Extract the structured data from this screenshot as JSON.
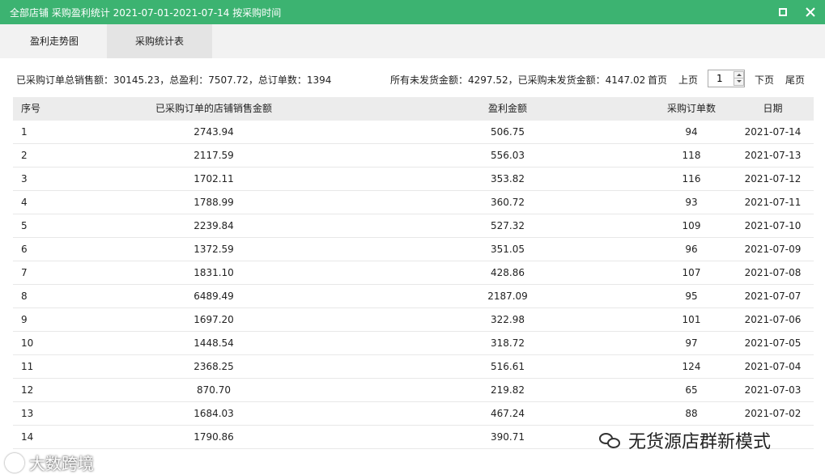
{
  "window": {
    "title": "全部店铺 采购盈利统计 2021-07-01-2021-07-14 按采购时间",
    "maximize_icon": "maximize-icon",
    "close_icon": "close-icon",
    "titlebar_color": "#3cb371"
  },
  "tabs": [
    {
      "label": "盈利走势图",
      "active": false
    },
    {
      "label": "采购统计表",
      "active": true
    }
  ],
  "summary": {
    "left": "已采购订单总销售额：30145.23，总盈利：7507.72，总订单数：1394",
    "right": "所有未发货金额：4297.52，已采购未发货金额：4147.02"
  },
  "pager": {
    "first": "首页",
    "prev": "上页",
    "page": "1",
    "next": "下页",
    "last": "尾页"
  },
  "table": {
    "headers": [
      "序号",
      "已采购订单的店铺销售金额",
      "盈利金额",
      "采购订单数",
      "日期"
    ],
    "rows": [
      [
        "1",
        "2743.94",
        "506.75",
        "94",
        "2021-07-14"
      ],
      [
        "2",
        "2117.59",
        "556.03",
        "118",
        "2021-07-13"
      ],
      [
        "3",
        "1702.11",
        "353.82",
        "116",
        "2021-07-12"
      ],
      [
        "4",
        "1788.99",
        "360.72",
        "93",
        "2021-07-11"
      ],
      [
        "5",
        "2239.84",
        "527.32",
        "109",
        "2021-07-10"
      ],
      [
        "6",
        "1372.59",
        "351.05",
        "96",
        "2021-07-09"
      ],
      [
        "7",
        "1831.10",
        "428.86",
        "107",
        "2021-07-08"
      ],
      [
        "8",
        "6489.49",
        "2187.09",
        "95",
        "2021-07-07"
      ],
      [
        "9",
        "1697.20",
        "322.98",
        "101",
        "2021-07-06"
      ],
      [
        "10",
        "1448.54",
        "318.72",
        "97",
        "2021-07-05"
      ],
      [
        "11",
        "2368.25",
        "516.61",
        "124",
        "2021-07-04"
      ],
      [
        "12",
        "870.70",
        "219.82",
        "65",
        "2021-07-03"
      ],
      [
        "13",
        "1684.03",
        "467.24",
        "88",
        "2021-07-02"
      ],
      [
        "14",
        "1790.86",
        "390.71",
        "",
        ""
      ]
    ]
  },
  "watermarks": {
    "left": "大数跨境",
    "right": "无货源店群新模式"
  }
}
